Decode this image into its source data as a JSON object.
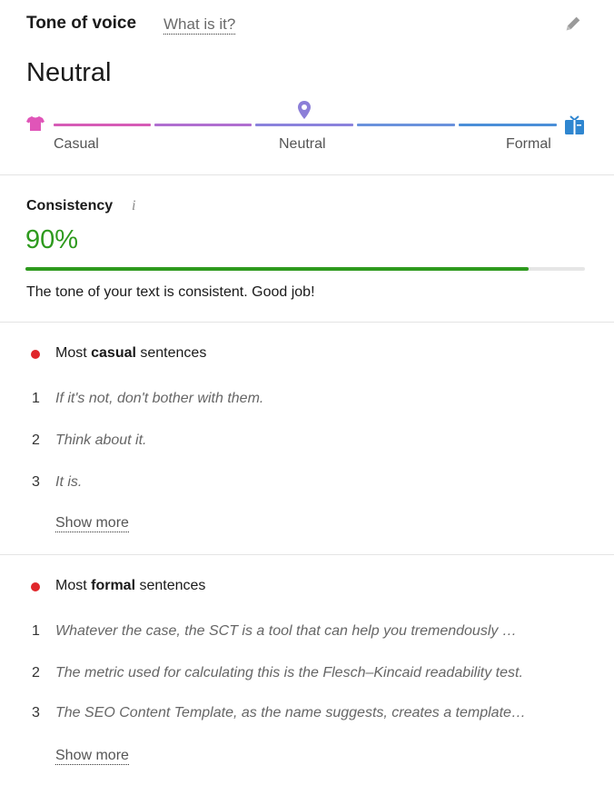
{
  "header": {
    "title": "Tone of voice",
    "help_link": "What is it?",
    "edit_icon": "pencil-icon",
    "tone_value": "Neutral"
  },
  "scale": {
    "left_icon": "casual-shirt-icon",
    "right_icon": "formal-suit-icon",
    "marker_icon": "location-pin-icon",
    "marker_position": "Neutral",
    "labels": [
      "Casual",
      "Neutral",
      "Formal"
    ],
    "segment_colors": [
      "#d65cb6",
      "#b06ed0",
      "#8a82dc",
      "#6a92dc",
      "#4a8fd8"
    ],
    "left_icon_color": "#e055b8",
    "right_icon_color": "#2f86d0",
    "marker_color": "#8c7fd8"
  },
  "consistency": {
    "label": "Consistency",
    "info_icon": "info-icon",
    "value_text": "90%",
    "value_fraction": 0.9,
    "color": "#2e9a1e",
    "message": "The tone of your text is consistent. Good job!"
  },
  "casual": {
    "heading_prefix": "Most ",
    "heading_bold": "casual",
    "heading_suffix": " sentences",
    "dot_color": "#e0262b",
    "items": [
      {
        "num": "1",
        "text": "If it's not, don't bother with them."
      },
      {
        "num": "2",
        "text": "Think about it."
      },
      {
        "num": "3",
        "text": "It is."
      }
    ],
    "show_more": "Show more"
  },
  "formal": {
    "heading_prefix": "Most ",
    "heading_bold": "formal",
    "heading_suffix": " sentences",
    "dot_color": "#e0262b",
    "items": [
      {
        "num": "1",
        "text": "Whatever the case, the SCT is a tool that can help you tremendously …"
      },
      {
        "num": "2",
        "text": "The metric used for calculating this is the Flesch–Kincaid readability test."
      },
      {
        "num": "3",
        "text": "The SEO Content Template, as the name suggests, creates a template…"
      }
    ],
    "show_more": "Show more"
  }
}
